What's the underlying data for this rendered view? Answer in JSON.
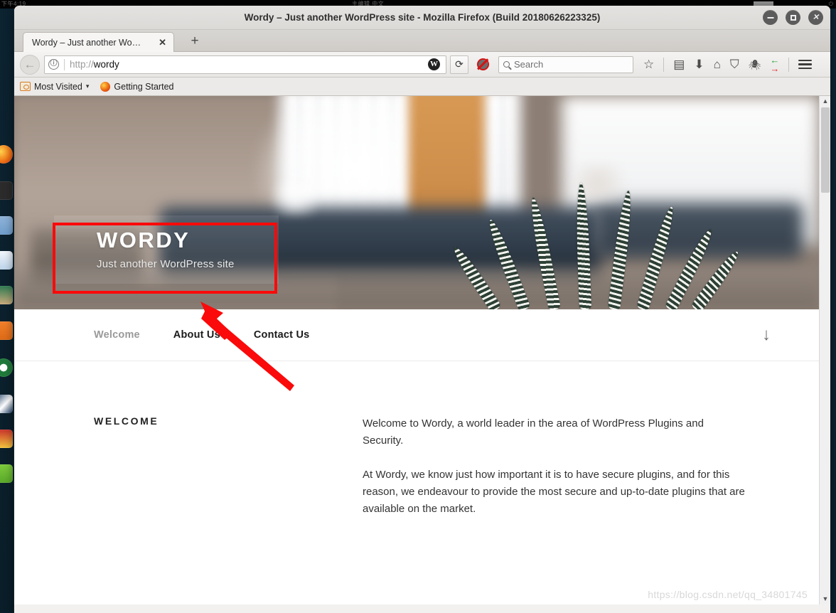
{
  "desktop": {
    "panel_left": "下午4:19",
    "panel_mid": "主编辑 中文",
    "panel_right": "⏻"
  },
  "window": {
    "title": "Wordy – Just another WordPress site - Mozilla Firefox (Build 20180626223325)",
    "controls": {
      "minimize": "minimize",
      "maximize": "maximize",
      "close": "close"
    }
  },
  "tabs": {
    "items": [
      {
        "title": "Wordy – Just another Wo…",
        "close": "✕"
      }
    ],
    "new_tab": "+"
  },
  "toolbar": {
    "back": "←",
    "url_scheme": "http://",
    "url_host": "wordy",
    "site_identity_icon": "ⓘ",
    "wordpress_icon": "W",
    "reload": "⟳",
    "noscript_label": "NoScript",
    "search_placeholder": "Search",
    "icons": [
      "bookmark-star",
      "library",
      "downloads",
      "home",
      "pocket",
      "hackbar",
      "foxyproxy",
      "menu"
    ]
  },
  "bookmarks": {
    "items": [
      {
        "label": "Most Visited",
        "has_caret": true
      },
      {
        "label": "Getting Started",
        "has_caret": false
      }
    ]
  },
  "page": {
    "hero": {
      "title": "WORDY",
      "subtitle": "Just another WordPress site"
    },
    "nav": [
      {
        "label": "Welcome",
        "state": "active"
      },
      {
        "label": "About Us",
        "state": "normal"
      },
      {
        "label": "Contact Us",
        "state": "normal"
      }
    ],
    "scroll_down_icon": "↓",
    "section": {
      "heading": "WELCOME",
      "paragraphs": [
        "Welcome to Wordy, a world leader in the area of WordPress Plugins and Security.",
        "At Wordy, we know just how important it is to have secure plugins, and for this reason, we endeavour to provide the most secure and up-to-date plugins that are available on the market."
      ]
    }
  },
  "watermark": "https://blog.csdn.net/qq_34801745",
  "scrollbar": {
    "up": "▲",
    "down": "▼"
  },
  "annotations": {
    "highlight_color": "#fa0a0a",
    "rectangle_target": "site-title-hero",
    "arrow_points_to": "site-title-hero"
  }
}
